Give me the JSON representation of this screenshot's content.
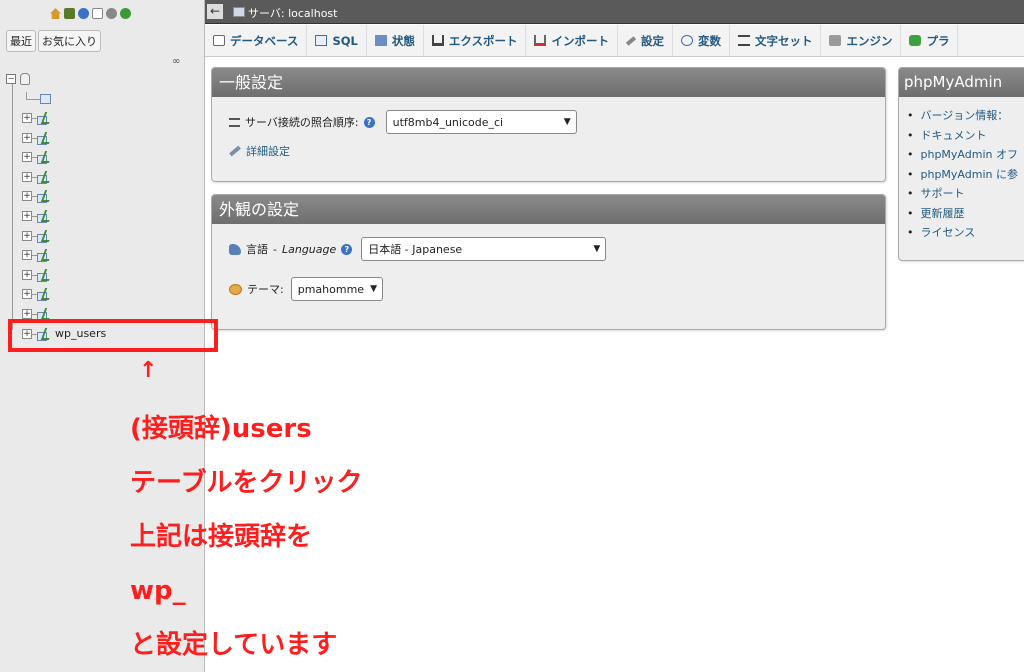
{
  "nav": {
    "tabs": [
      "最近",
      "お気に入り"
    ],
    "table_row_count": 11,
    "highlighted_table": "wp_users"
  },
  "topbar": {
    "breadcrumb": "サーバ: localhost"
  },
  "menu": [
    {
      "label": "データベース",
      "icon": "database-icon"
    },
    {
      "label": "SQL",
      "icon": "sql-icon"
    },
    {
      "label": "状態",
      "icon": "status-icon"
    },
    {
      "label": "エクスポート",
      "icon": "export-icon"
    },
    {
      "label": "インポート",
      "icon": "import-icon"
    },
    {
      "label": "設定",
      "icon": "wrench-icon"
    },
    {
      "label": "変数",
      "icon": "variables-icon"
    },
    {
      "label": "文字セット",
      "icon": "charset-icon"
    },
    {
      "label": "エンジン",
      "icon": "engine-icon"
    },
    {
      "label": "プラ",
      "icon": "plugin-icon"
    }
  ],
  "general": {
    "title": "一般設定",
    "collation_label": "サーバ接続の照合順序:",
    "collation_value": "utf8mb4_unicode_ci",
    "more_settings": "詳細設定"
  },
  "appearance": {
    "title": "外観の設定",
    "language_label": "言語",
    "language_label_en": "Language",
    "language_value": "日本語 - Japanese",
    "theme_label": "テーマ:",
    "theme_value": "pmahomme"
  },
  "pma": {
    "title": "phpMyAdmin",
    "items": [
      "バージョン情報：",
      "ドキュメント",
      "phpMyAdmin オフ",
      "phpMyAdmin に参",
      "サポート",
      "更新履歴",
      "ライセンス"
    ]
  },
  "annotation": {
    "arrow": "↑",
    "lines": [
      "(接頭辞)users",
      "テーブルをクリック",
      "上記は接頭辞を",
      "wp_",
      "と設定しています"
    ]
  },
  "colors": {
    "accent_red": "#ff1e1e",
    "link_blue": "#235a81",
    "panel_header": "#7b7b7b"
  }
}
